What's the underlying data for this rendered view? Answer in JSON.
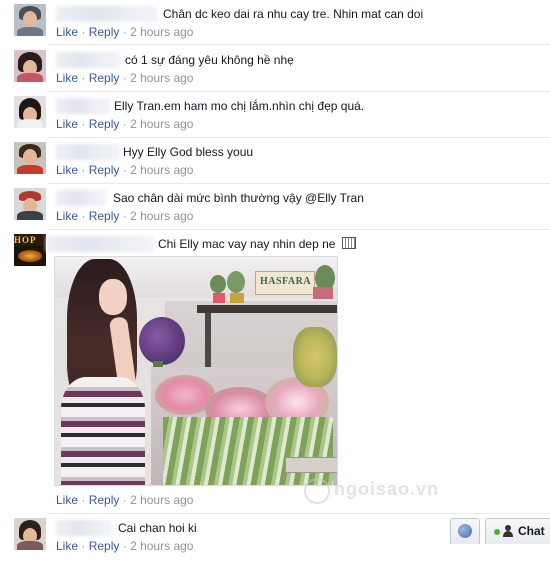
{
  "comments": [
    {
      "text": "Chân dc keo dai ra nhu cay tre. Nhin mat can doi",
      "like": "Like",
      "reply": "Reply",
      "sep": "·",
      "time": "2 hours ago"
    },
    {
      "text": "có 1 sự đáng yêu không hề nhẹ",
      "like": "Like",
      "reply": "Reply",
      "sep": "·",
      "time": "2 hours ago"
    },
    {
      "text": "Elly Tran.em ham mo chị lắm.nhìn chị đẹp quá.",
      "like": "Like",
      "reply": "Reply",
      "sep": "·",
      "time": "2 hours ago"
    },
    {
      "text": "Hyy Elly God bless youu",
      "like": "Like",
      "reply": "Reply",
      "sep": "·",
      "time": "2 hours ago"
    },
    {
      "text": "Sao chân dài mức bình thường vậy @Elly Tran",
      "like": "Like",
      "reply": "Reply",
      "sep": "·",
      "time": "2 hours ago"
    },
    {
      "text": "Chi Elly mac vay nay nhin dep ne",
      "like": "Like",
      "reply": "Reply",
      "sep": "·",
      "time": "2 hours ago"
    },
    {
      "text": "Cai chan hoi ki",
      "like": "Like",
      "reply": "Reply",
      "sep": "·",
      "time": "2 hours ago"
    }
  ],
  "photo": {
    "shop_sign": "HASFARA"
  },
  "avatar_label": "HOP",
  "chat": {
    "label": "Chat"
  },
  "watermark": "ngoisao.vn",
  "colors": {
    "link": "#3b5998",
    "time": "#90949c",
    "text": "#141823"
  }
}
